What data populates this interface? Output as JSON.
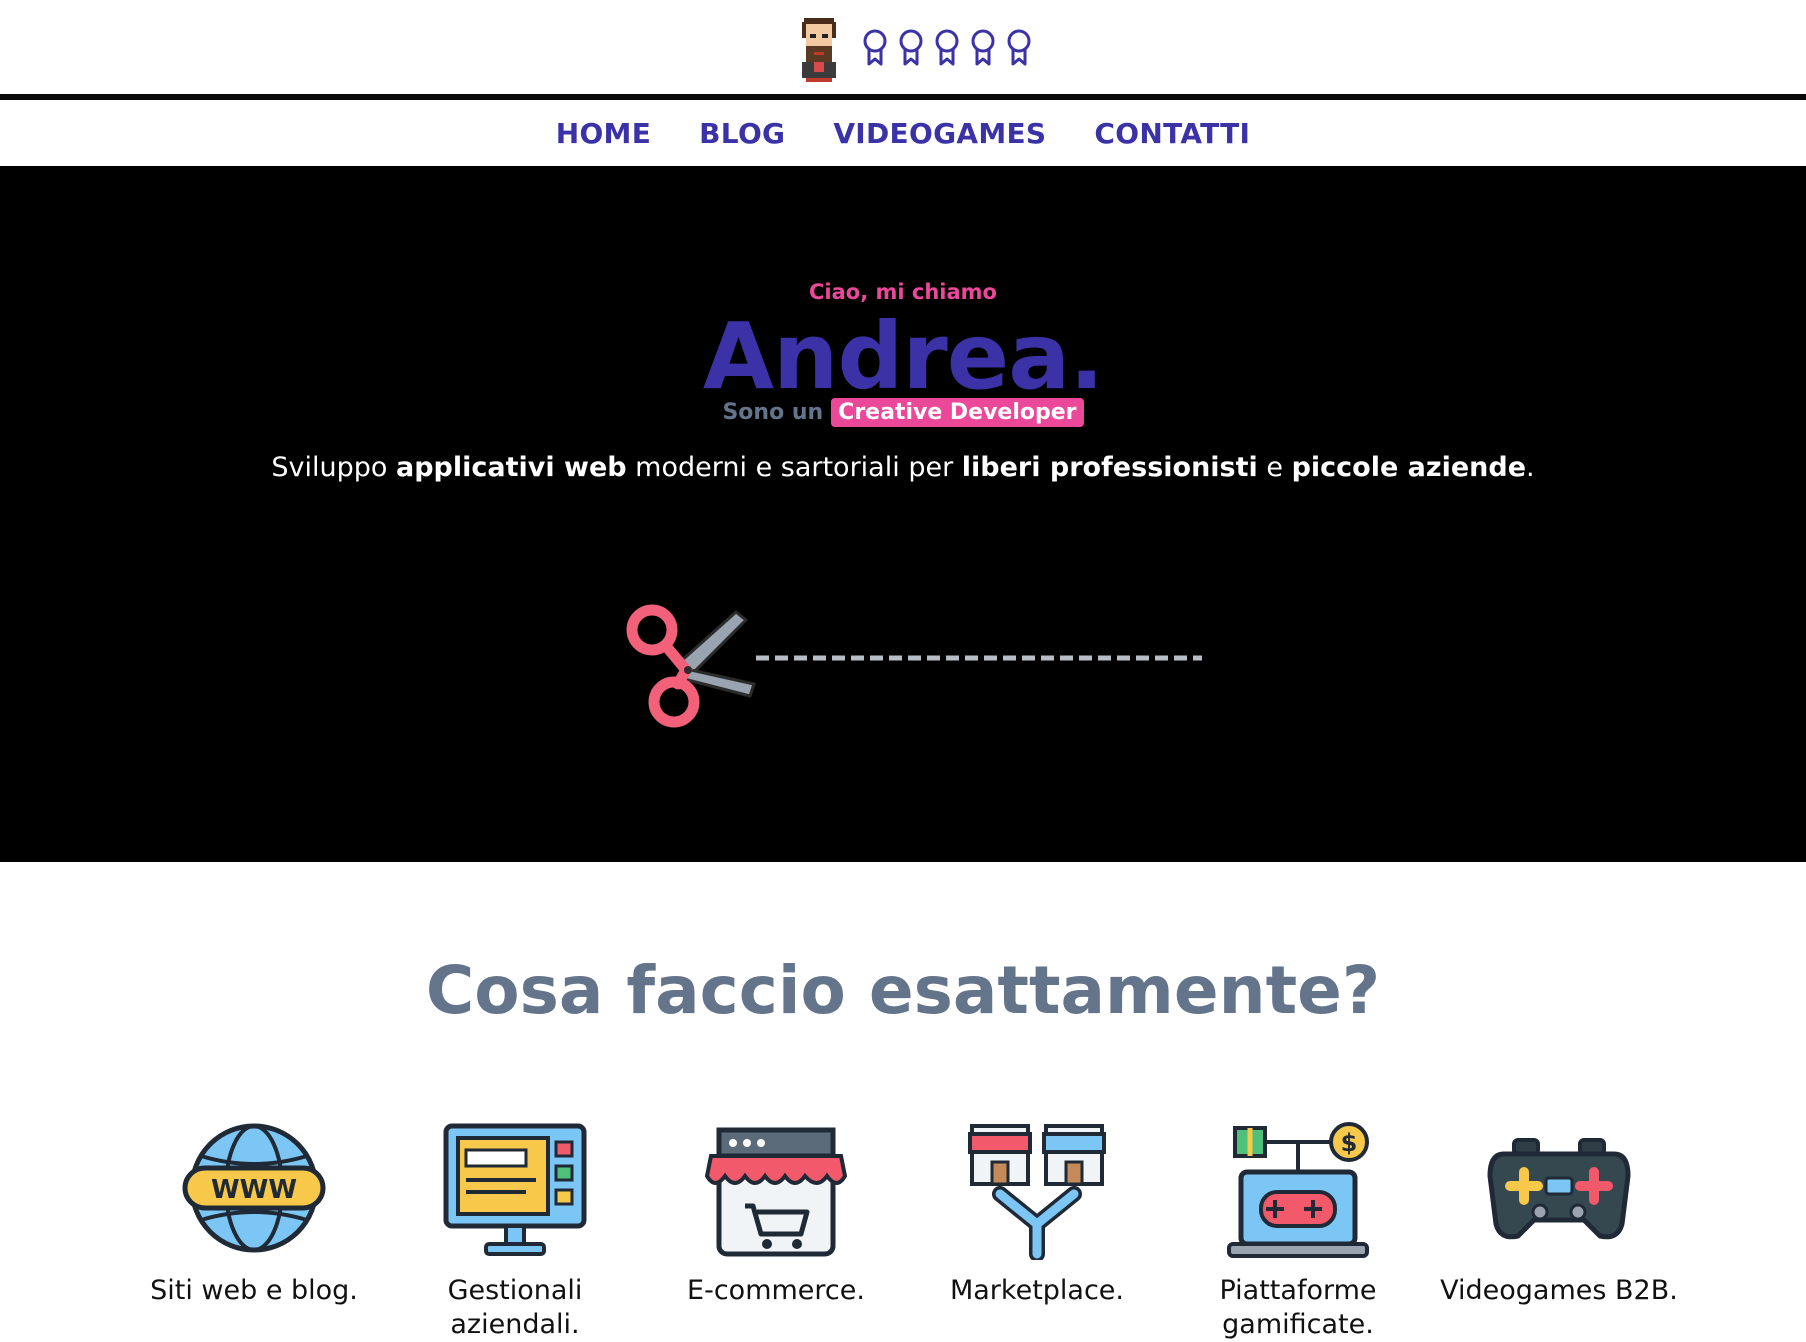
{
  "header": {
    "avatar_icon": "pixel-avatar-icon",
    "badge_icons": [
      "badge-icon",
      "badge-icon",
      "badge-icon",
      "badge-icon",
      "badge-icon"
    ],
    "accent_color": "#3a32a6"
  },
  "nav": {
    "items": [
      {
        "label": "HOME"
      },
      {
        "label": "BLOG"
      },
      {
        "label": "VIDEOGAMES"
      },
      {
        "label": "CONTATTI"
      }
    ]
  },
  "hero": {
    "greeting": "Ciao, mi chiamo",
    "name": "Andrea.",
    "role_prefix": "Sono un",
    "role": "Creative Developer",
    "tagline": {
      "p1": "Sviluppo ",
      "b1": "applicativi web",
      "p2": " moderni e sartoriali per ",
      "b2": "liberi professionisti",
      "p3": " e ",
      "b3": "piccole aziende",
      "p4": "."
    },
    "scissors_icon": "scissors-icon",
    "background": "#000000",
    "pink": "#ec4899"
  },
  "section": {
    "title": "Cosa faccio esattamente?"
  },
  "services": [
    {
      "icon": "www-globe-icon",
      "label": "Siti web e blog."
    },
    {
      "icon": "management-dashboard-icon",
      "label": "Gestionali aziendali."
    },
    {
      "icon": "storefront-cart-icon",
      "label": "E-commerce."
    },
    {
      "icon": "marketplace-shops-icon",
      "label": "Marketplace."
    },
    {
      "icon": "gamified-laptop-icon",
      "label": "Piattaforme gamificate."
    },
    {
      "icon": "gamepad-icon",
      "label": "Videogames B2B."
    }
  ]
}
